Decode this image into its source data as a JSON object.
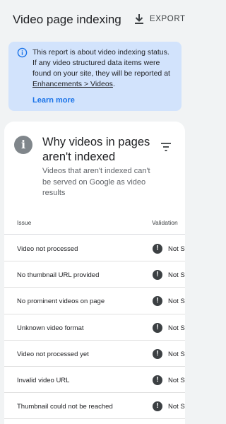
{
  "header": {
    "title": "Video page indexing",
    "export_label": "EXPORT"
  },
  "info_banner": {
    "text_before_link": "This report is about video indexing status. If any video structured data items were found on your site, they will be reported at ",
    "link_text": "Enhancements > Videos",
    "text_after_link": ".",
    "learn_more": "Learn more"
  },
  "card": {
    "title": "Why videos in pages aren't indexed",
    "subtitle": "Videos that aren't indexed can't be served on Google as video results"
  },
  "table": {
    "headers": {
      "issue": "Issue",
      "validation": "Validation"
    },
    "rows": [
      {
        "issue": "Video not processed",
        "status": "Not Started"
      },
      {
        "issue": "No thumbnail URL provided",
        "status": "Not Started"
      },
      {
        "issue": "No prominent videos on page",
        "status": "Not Started"
      },
      {
        "issue": "Unknown video format",
        "status": "Not Started"
      },
      {
        "issue": "Video not processed yet",
        "status": "Not Started"
      },
      {
        "issue": "Invalid video URL",
        "status": "Not Started"
      },
      {
        "issue": "Thumbnail could not be reached",
        "status": "Not Started"
      }
    ]
  },
  "colors": {
    "banner_bg": "#d2e3fc",
    "link_blue": "#1a73e8",
    "page_bg": "#f1f3f4"
  },
  "icons": [
    "download-icon",
    "info-outline-icon",
    "info-filled-icon",
    "filter-icon",
    "warning-icon"
  ]
}
